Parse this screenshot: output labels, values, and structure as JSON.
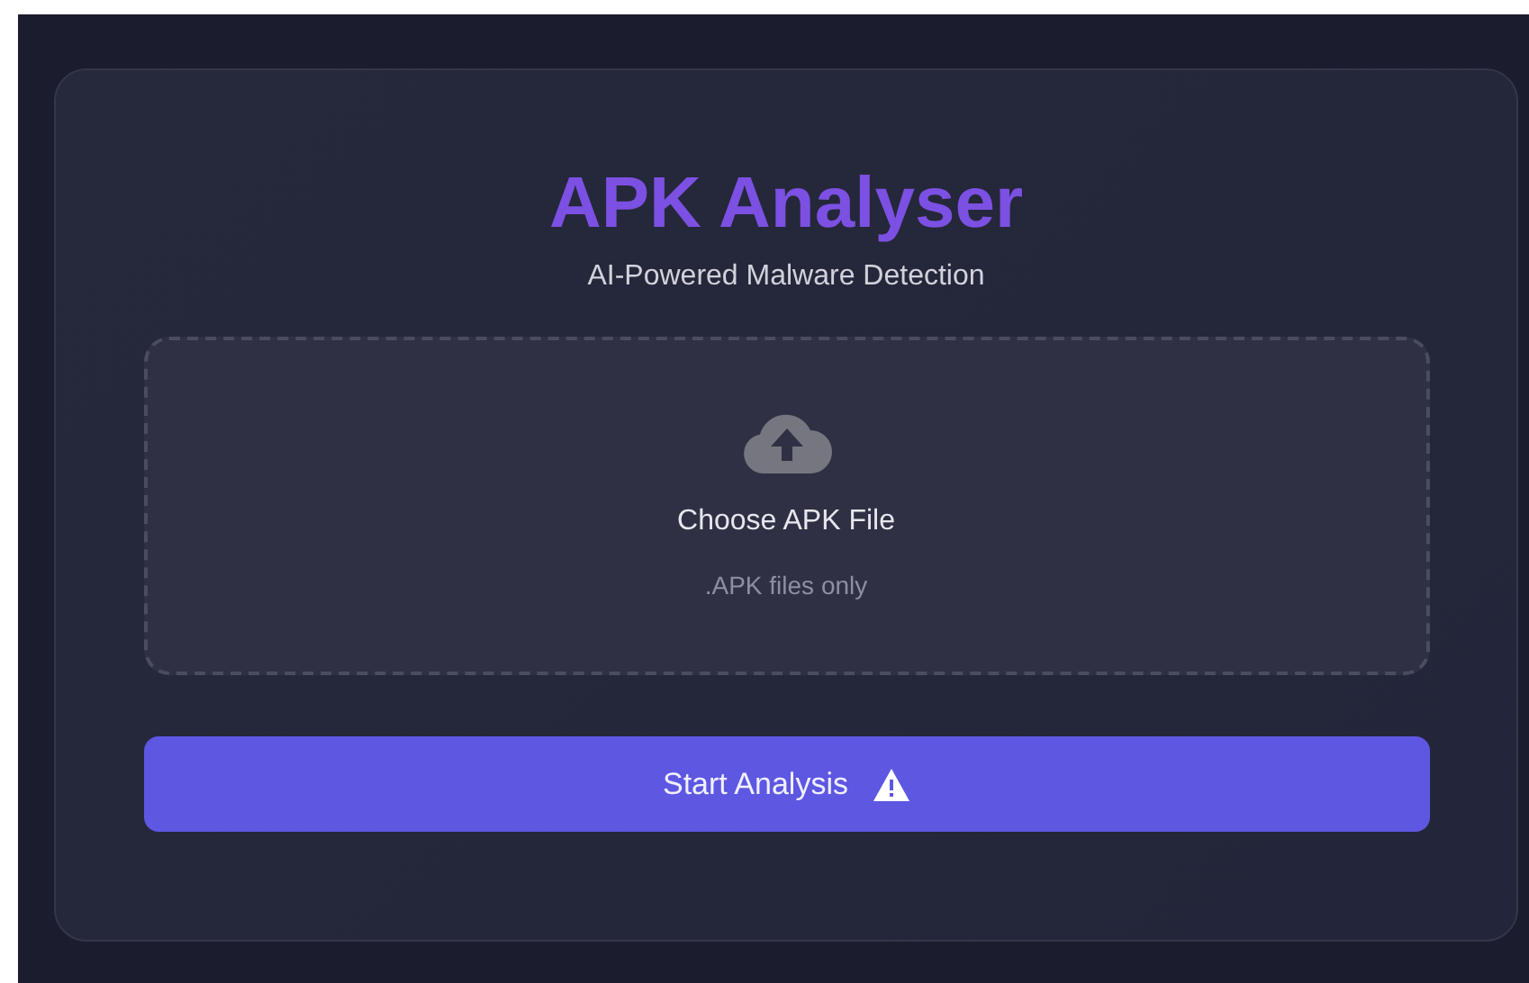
{
  "app": {
    "title": "APK Analyser",
    "subtitle": "AI-Powered Malware Detection"
  },
  "upload": {
    "label": "Choose APK File",
    "hint": ".APK files only"
  },
  "button": {
    "label": "Start Analysis",
    "disabled": false
  }
}
